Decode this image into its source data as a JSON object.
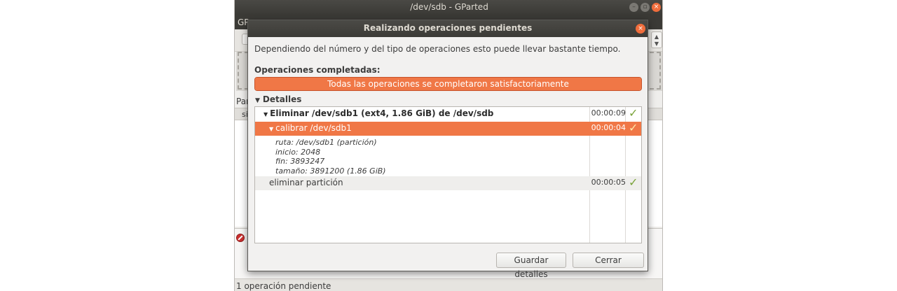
{
  "main_window": {
    "title": "/dev/sdb - GParted",
    "menubar_text": "GP",
    "panel_label": "Par",
    "list_header": "si",
    "status_text": "1 operación pendiente"
  },
  "dialog": {
    "title": "Realizando operaciones pendientes",
    "description": "Dependiendo del número y del tipo de operaciones esto puede llevar bastante tiempo.",
    "completed_label": "Operaciones completadas:",
    "progress": {
      "fraction": 1.0,
      "text": "Todas las operaciones se completaron satisfactoriamente"
    },
    "details_label": "Detalles",
    "operations": [
      {
        "label": "Eliminar /dev/sdb1 (ext4, 1.86 GiB) de /dev/sdb",
        "time": "00:00:09",
        "status_icon": "check-icon"
      },
      {
        "label": "calibrar /dev/sdb1",
        "time": "00:00:04",
        "status_icon": "check-icon"
      },
      {
        "label": "eliminar partición",
        "time": "00:00:05",
        "status_icon": "check-icon"
      }
    ],
    "detail_lines": [
      "ruta: /dev/sdb1 (partición)",
      "inicio: 2048",
      "fin: 3893247",
      "tamaño: 3891200 (1.86 GiB)"
    ],
    "buttons": {
      "save": "Guardar detalles",
      "close": "Cerrar"
    }
  },
  "colors": {
    "accent": "#f07746",
    "titlebar": "#3c3b37",
    "success_check": "#7aa33a"
  }
}
